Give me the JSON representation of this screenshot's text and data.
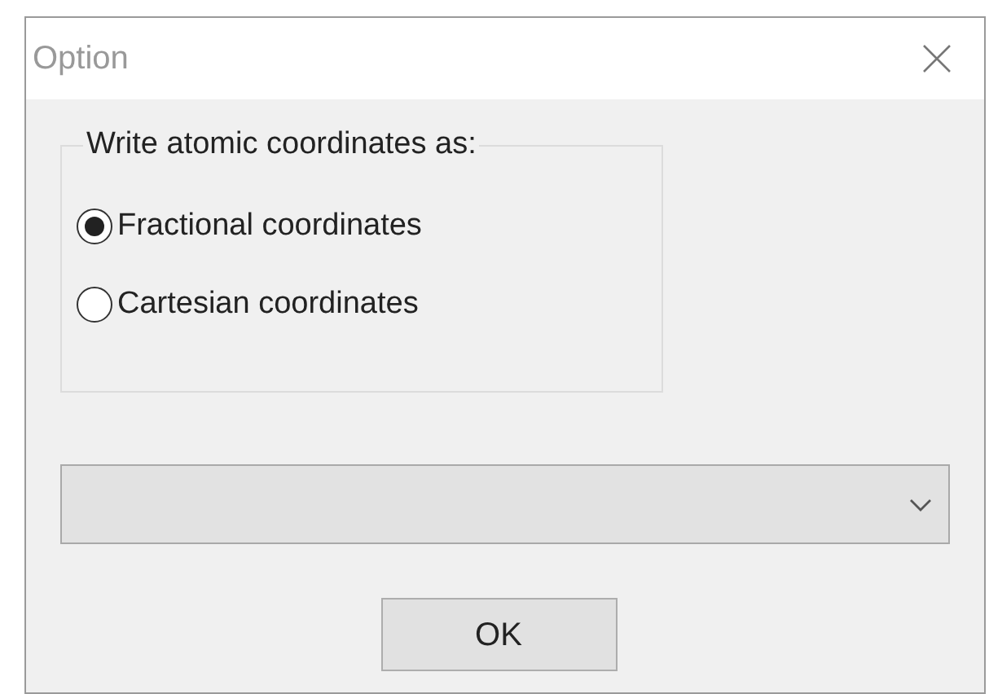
{
  "window": {
    "title": "Option"
  },
  "group": {
    "label": "Write atomic coordinates as:",
    "options": [
      {
        "label": "Fractional coordinates",
        "selected": true
      },
      {
        "label": "Cartesian coordinates",
        "selected": false
      }
    ]
  },
  "buttons": [
    "OK"
  ]
}
